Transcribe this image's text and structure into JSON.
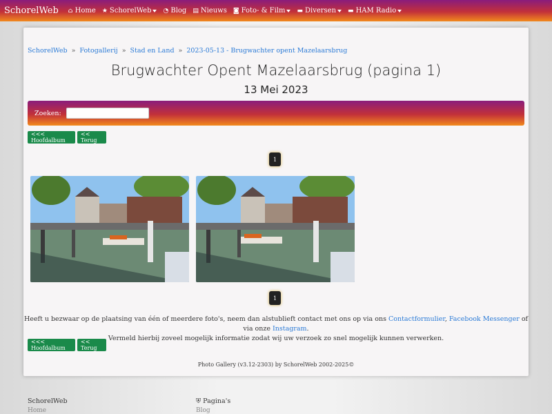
{
  "navbar": {
    "brand": "SchorelWeb",
    "items": [
      {
        "label": "Home",
        "icon": "home-icon",
        "dropdown": false
      },
      {
        "label": "SchorelWeb",
        "icon": "star-icon",
        "dropdown": true
      },
      {
        "label": "Blog",
        "icon": "rss-icon",
        "dropdown": false
      },
      {
        "label": "Nieuws",
        "icon": "newspaper-icon",
        "dropdown": false
      },
      {
        "label": "Foto- & Film",
        "icon": "camera-icon",
        "dropdown": true
      },
      {
        "label": "Diversen",
        "icon": "folder-icon",
        "dropdown": true
      },
      {
        "label": "HAM Radio",
        "icon": "folder-icon",
        "dropdown": true
      }
    ]
  },
  "breadcrumb": [
    "SchorelWeb",
    "Fotogallerij",
    "Stad en Land",
    "2023-05-13 - Brugwachter opent Mazelaarsbrug"
  ],
  "breadcrumb_sep": "»",
  "page": {
    "title": "Brugwachter Opent Mazelaarsbrug (pagina 1)",
    "subtitle": "13 Mei 2023"
  },
  "search": {
    "label": "Zoeken:",
    "value": ""
  },
  "buttons": {
    "main_album": "<<< Hoofdalbum",
    "back": "<< Terug"
  },
  "pagination": {
    "current": "1"
  },
  "notice": {
    "text1": "Heeft u bezwaar op de plaatsing van één of meerdere foto's, neem dan alstublieft contact met ons op via ons ",
    "link1": "Contactformulier",
    "text2": ", ",
    "link2": "Facebook Messenger",
    "text3": " of via onze ",
    "link3": "Instagram",
    "text4": ".",
    "line2": "Vermeld hierbij zoveel mogelijk informatie zodat wij uw verzoek zo snel mogelijk kunnen verwerken."
  },
  "credit": "Photo Gallery (v3.12-2303) by SchorelWeb 2002-2025©",
  "footer": {
    "col1_title": "SchorelWeb",
    "col1_item": "Home",
    "col2_title": "Pagina's",
    "col2_icon": "shield-icon",
    "col2_item": "Blog"
  },
  "colors": {
    "accent_start": "#8a1c7c",
    "accent_end": "#f28a1c",
    "button": "#1a8a4a",
    "link": "#2a7ad6"
  }
}
